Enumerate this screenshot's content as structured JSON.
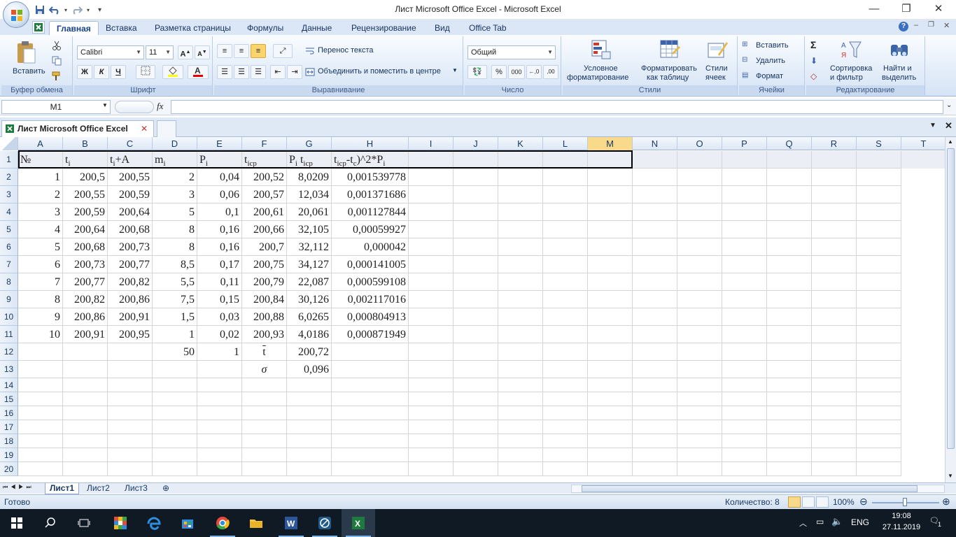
{
  "window": {
    "title": "Лист Microsoft Office Excel - Microsoft Excel",
    "minimize": "—",
    "restore": "❐",
    "close": "✕"
  },
  "ribbon_tabs": [
    "Главная",
    "Вставка",
    "Разметка страницы",
    "Формулы",
    "Данные",
    "Рецензирование",
    "Вид",
    "Office Tab"
  ],
  "ribbon": {
    "clipboard": {
      "paste": "Вставить",
      "label": "Буфер обмена"
    },
    "font": {
      "name": "Calibri",
      "size": "11",
      "bold": "Ж",
      "italic": "К",
      "underline": "Ч",
      "label": "Шрифт"
    },
    "alignment": {
      "wrap": "Перенос текста",
      "merge": "Объединить и поместить в центре",
      "label": "Выравнивание"
    },
    "number": {
      "format": "Общий",
      "percent": "%",
      "thousands": "000",
      "label": "Число"
    },
    "styles": {
      "conditional": "Условное",
      "conditional2": "форматирование",
      "as_table": "Форматировать",
      "as_table2": "как таблицу",
      "cell_styles": "Стили",
      "cell_styles2": "ячеек",
      "label": "Стили"
    },
    "cells": {
      "insert": "Вставить",
      "delete": "Удалить",
      "format": "Формат",
      "label": "Ячейки"
    },
    "editing": {
      "sort": "Сортировка",
      "sort2": "и фильтр",
      "find": "Найти и",
      "find2": "выделить",
      "label": "Редактирование"
    }
  },
  "formula_bar": {
    "namebox": "M1",
    "fx": "fx",
    "value": ""
  },
  "doc_tab": {
    "name": "Лист Microsoft Office Excel"
  },
  "columns": [
    "A",
    "B",
    "C",
    "D",
    "E",
    "F",
    "G",
    "H",
    "I",
    "J",
    "K",
    "L",
    "M",
    "N",
    "O",
    "P",
    "Q",
    "R",
    "S",
    "T"
  ],
  "headers": {
    "A": "№",
    "B": "t",
    "B_sub": "i",
    "C": "t",
    "C_sub": "i",
    "C_rest": "+A",
    "D": "m",
    "D_sub": "i",
    "E": "P",
    "E_sub": "i",
    "F": "t",
    "F_sub": "icp",
    "G": "P",
    "G_sub": "i",
    "G_mid": " t",
    "G_sub2": "icp",
    "H": "t",
    "H_sub": "icp",
    "H_mid": "-t",
    "H_sub2": "c",
    "H_rest": ")^2*P",
    "H_sub3": "i"
  },
  "rows": [
    [
      "1",
      "200,5",
      "200,55",
      "2",
      "0,04",
      "200,52",
      "8,0209",
      "0,001539778"
    ],
    [
      "2",
      "200,55",
      "200,59",
      "3",
      "0,06",
      "200,57",
      "12,034",
      "0,001371686"
    ],
    [
      "3",
      "200,59",
      "200,64",
      "5",
      "0,1",
      "200,61",
      "20,061",
      "0,001127844"
    ],
    [
      "4",
      "200,64",
      "200,68",
      "8",
      "0,16",
      "200,66",
      "32,105",
      "0,00059927"
    ],
    [
      "5",
      "200,68",
      "200,73",
      "8",
      "0,16",
      "200,7",
      "32,112",
      "0,000042"
    ],
    [
      "6",
      "200,73",
      "200,77",
      "8,5",
      "0,17",
      "200,75",
      "34,127",
      "0,000141005"
    ],
    [
      "7",
      "200,77",
      "200,82",
      "5,5",
      "0,11",
      "200,79",
      "22,087",
      "0,000599108"
    ],
    [
      "8",
      "200,82",
      "200,86",
      "7,5",
      "0,15",
      "200,84",
      "30,126",
      "0,002117016"
    ],
    [
      "9",
      "200,86",
      "200,91",
      "1,5",
      "0,03",
      "200,88",
      "6,0265",
      "0,000804913"
    ],
    [
      "10",
      "200,91",
      "200,95",
      "1",
      "0,02",
      "200,93",
      "4,0186",
      "0,000871949"
    ]
  ],
  "row12": {
    "D": "50",
    "E": "1",
    "F": "t",
    "G": "200,72"
  },
  "row13": {
    "F": "σ",
    "G": "0,096"
  },
  "row_numbers": [
    "1",
    "2",
    "3",
    "4",
    "5",
    "6",
    "7",
    "8",
    "9",
    "10",
    "11",
    "12",
    "13",
    "14",
    "15",
    "16",
    "17",
    "18",
    "19",
    "20"
  ],
  "sheets": [
    "Лист1",
    "Лист2",
    "Лист3"
  ],
  "status": {
    "ready": "Готово",
    "count": "Количество: 8",
    "zoom": "100%"
  },
  "taskbar": {
    "lang": "ENG",
    "time": "19:08",
    "date": "27.11.2019",
    "notif": "1"
  },
  "colors": {
    "ribbon_bg": "#dbe7f6",
    "accent": "#15428b",
    "taskbar": "#101a24"
  }
}
